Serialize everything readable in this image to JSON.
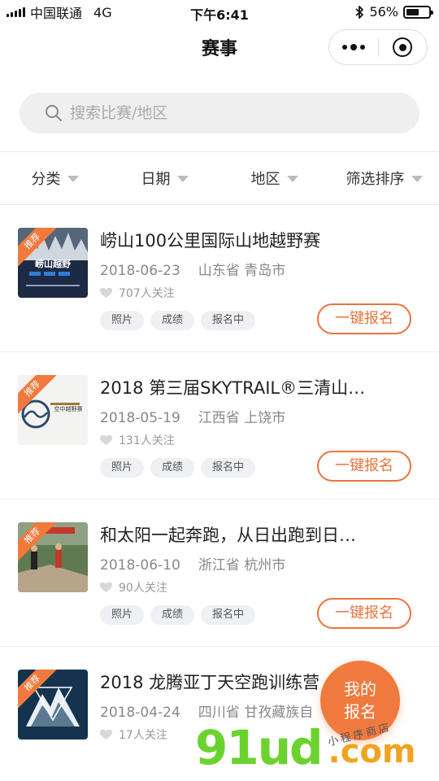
{
  "status_bar": {
    "carrier": "中国联通",
    "network": "4G",
    "time": "下午6:41",
    "battery_percent": "56%",
    "battery_level": 0.56
  },
  "nav": {
    "title": "赛事"
  },
  "search": {
    "placeholder": "搜索比赛/地区"
  },
  "filters": [
    {
      "label": "分类"
    },
    {
      "label": "日期"
    },
    {
      "label": "地区"
    },
    {
      "label": "筛选排序"
    }
  ],
  "events": [
    {
      "badge": "推荐",
      "title": "崂山100公里国际山地越野赛",
      "date": "2018-06-23",
      "location": "山东省 青岛市",
      "follows": "707人关注",
      "chips": [
        "照片",
        "成绩",
        "报名中"
      ],
      "button": "一键报名",
      "thumb_caption": "崂山越野"
    },
    {
      "badge": "推荐",
      "title": "2018 第三届SKYTRAIL®三清山…",
      "date": "2018-05-19",
      "location": "江西省 上饶市",
      "follows": "131人关注",
      "chips": [
        "照片",
        "成绩",
        "报名中"
      ],
      "button": "一键报名",
      "thumb_caption": "空中越野赛"
    },
    {
      "badge": "推荐",
      "title": "和太阳一起奔跑，从日出跑到日…",
      "date": "2018-06-10",
      "location": "浙江省 杭州市",
      "follows": "90人关注",
      "chips": [
        "照片",
        "成绩",
        "报名中"
      ],
      "button": "一键报名"
    },
    {
      "badge": "推荐",
      "title": "2018 龙腾亚丁天空跑训练营",
      "date": "2018-04-24",
      "location": "四川省 甘孜藏族自",
      "follows": "17人关注"
    }
  ],
  "fab": {
    "line1": "我的",
    "line2": "报名"
  },
  "watermark": {
    "main": "91ud",
    "suffix": ".com",
    "script": "小程序商店"
  },
  "colors": {
    "accent": "#f07a3e",
    "button_border": "#e9753c",
    "chip_bg": "#eef0f3"
  }
}
